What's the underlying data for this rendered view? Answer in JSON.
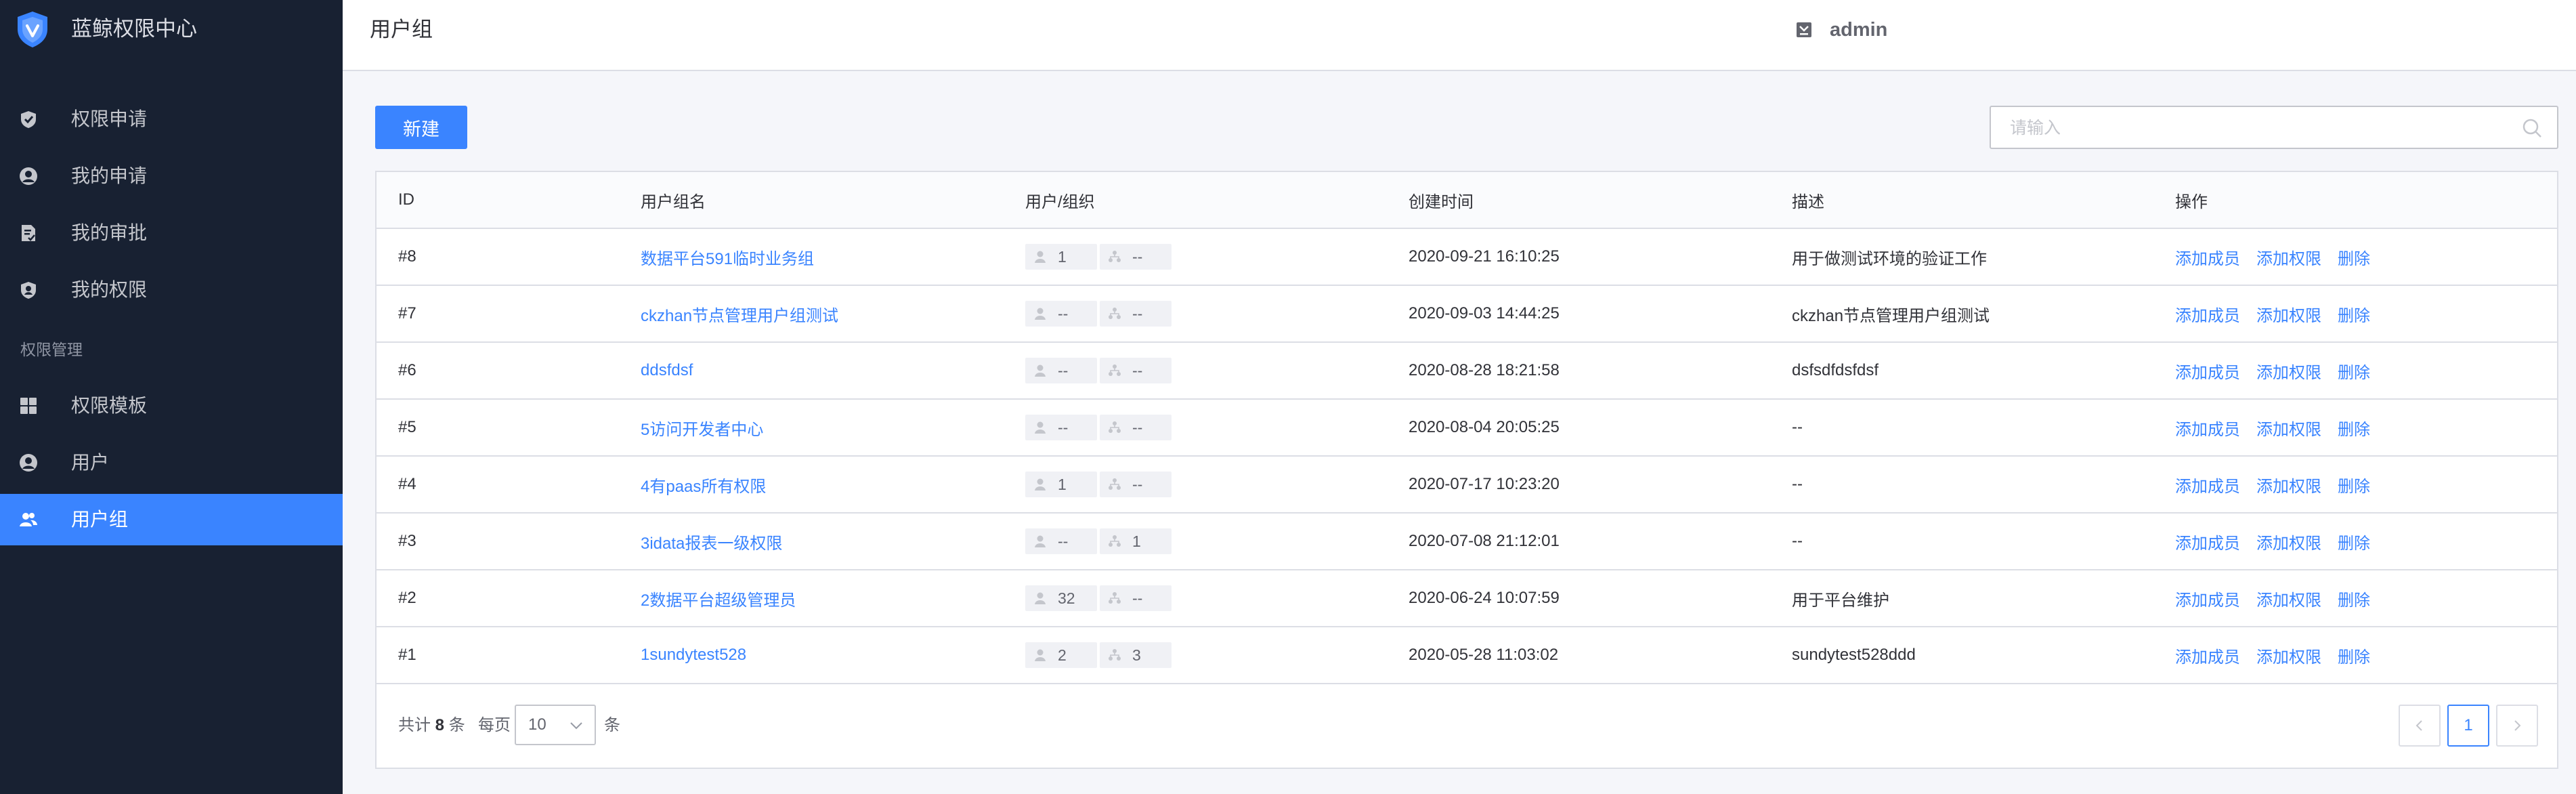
{
  "app": {
    "title": "蓝鲸权限中心"
  },
  "sidebar": {
    "items": [
      {
        "label": "权限申请",
        "icon": "shield-apply-icon"
      },
      {
        "label": "我的申请",
        "icon": "user-circle-icon"
      },
      {
        "label": "我的审批",
        "icon": "document-check-icon"
      },
      {
        "label": "我的权限",
        "icon": "shield-user-icon"
      }
    ],
    "group_label": "权限管理",
    "admin_items": [
      {
        "label": "权限模板",
        "icon": "grid-icon"
      },
      {
        "label": "用户",
        "icon": "user-circle-icon"
      },
      {
        "label": "用户组",
        "icon": "users-icon",
        "active": true
      }
    ]
  },
  "header": {
    "title": "用户组",
    "username": "admin"
  },
  "toolbar": {
    "new_label": "新建",
    "search_placeholder": "请输入"
  },
  "table": {
    "columns": [
      "ID",
      "用户组名",
      "用户/组织",
      "创建时间",
      "描述",
      "操作"
    ],
    "actions": [
      "添加成员",
      "添加权限",
      "删除"
    ],
    "rows": [
      {
        "id": "#8",
        "name": "数据平台591临时业务组",
        "users": "1",
        "orgs": "--",
        "created": "2020-09-21 16:10:25",
        "desc": "用于做测试环境的验证工作"
      },
      {
        "id": "#7",
        "name": "ckzhan节点管理用户组测试",
        "users": "--",
        "orgs": "--",
        "created": "2020-09-03 14:44:25",
        "desc": "ckzhan节点管理用户组测试"
      },
      {
        "id": "#6",
        "name": "ddsfdsf",
        "users": "--",
        "orgs": "--",
        "created": "2020-08-28 18:21:58",
        "desc": "dsfsdfdsfdsf"
      },
      {
        "id": "#5",
        "name": "5访问开发者中心",
        "users": "--",
        "orgs": "--",
        "created": "2020-08-04 20:05:25",
        "desc": "--"
      },
      {
        "id": "#4",
        "name": "4有paas所有权限",
        "users": "1",
        "orgs": "--",
        "created": "2020-07-17 10:23:20",
        "desc": "--"
      },
      {
        "id": "#3",
        "name": "3idata报表一级权限",
        "users": "--",
        "orgs": "1",
        "created": "2020-07-08 21:12:01",
        "desc": "--"
      },
      {
        "id": "#2",
        "name": "2数据平台超级管理员",
        "users": "32",
        "orgs": "--",
        "created": "2020-06-24 10:07:59",
        "desc": "用于平台维护"
      },
      {
        "id": "#1",
        "name": "1sundytest528",
        "users": "2",
        "orgs": "3",
        "created": "2020-05-28 11:03:02",
        "desc": "sundytest528ddd"
      }
    ]
  },
  "pagination": {
    "total_prefix": "共计",
    "total": "8",
    "total_suffix": "条",
    "per_page_label": "每页",
    "page_size": "10",
    "unit": "条",
    "current_page": "1"
  },
  "colors": {
    "accent": "#3a84ff",
    "sidebar_bg": "#182132"
  }
}
